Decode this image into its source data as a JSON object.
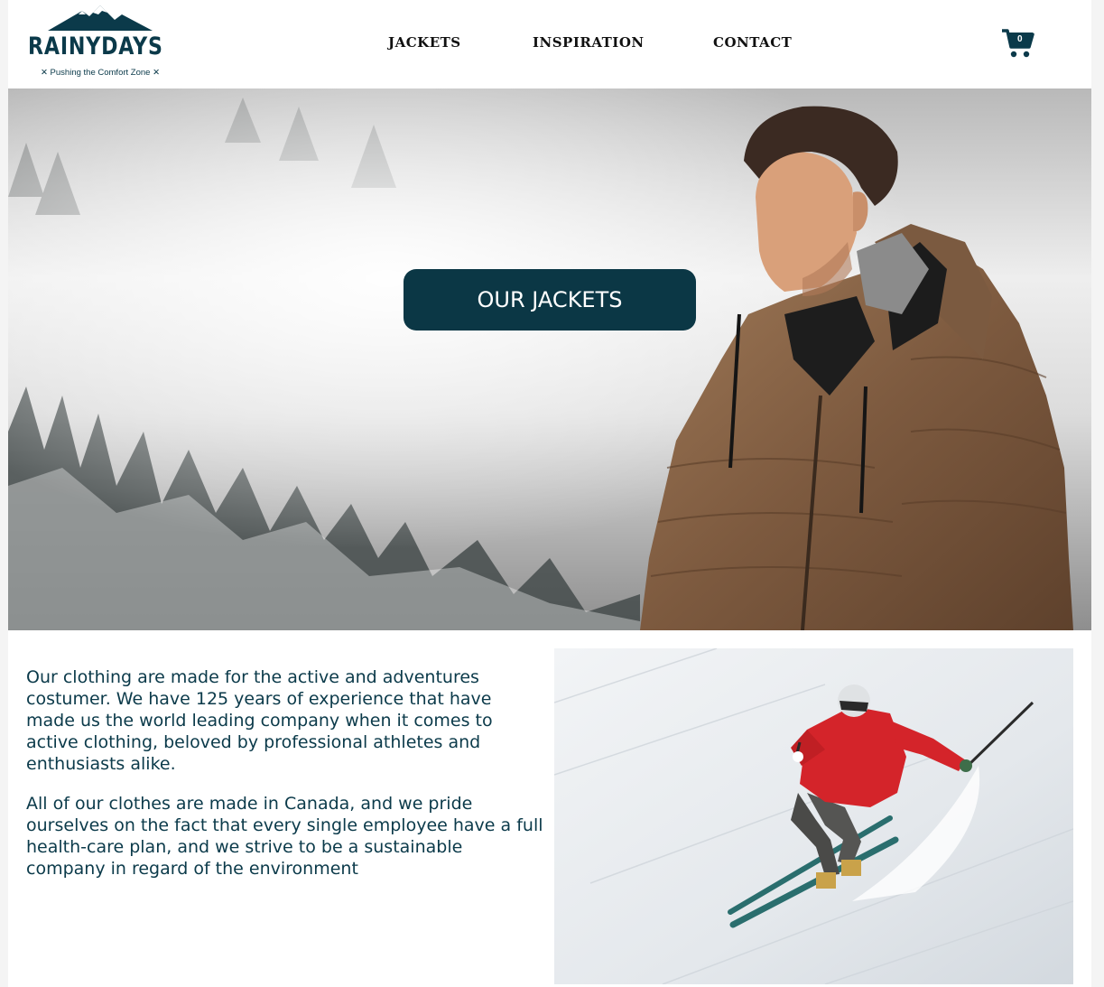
{
  "brand": {
    "name": "RAINYDAYS",
    "tagline": "✕ Pushing the Comfort Zone ✕"
  },
  "nav": {
    "items": [
      {
        "label": "JACKETS"
      },
      {
        "label": "INSPIRATION"
      },
      {
        "label": "CONTACT"
      }
    ]
  },
  "cart": {
    "count": "0",
    "icon": "shopping-cart-icon"
  },
  "hero": {
    "button_label": "OUR JACKETS"
  },
  "about": {
    "paragraphs": [
      "Our clothing are made for the active and adventures costumer. We have 125 years of experience that have made us the world leading company when it comes to active clothing, beloved by professional athletes and enthusiasts alike.",
      "All of our clothes are made in Canada, and we pride ourselves on the fact that every single employee have a full health-care plan, and we strive to be a sustainable company in regard of the environment"
    ]
  },
  "colors": {
    "brand_dark": "#0b3745",
    "text": "#0b3a4a",
    "jacket": "#8a6446",
    "ski_jacket": "#d4242a"
  }
}
